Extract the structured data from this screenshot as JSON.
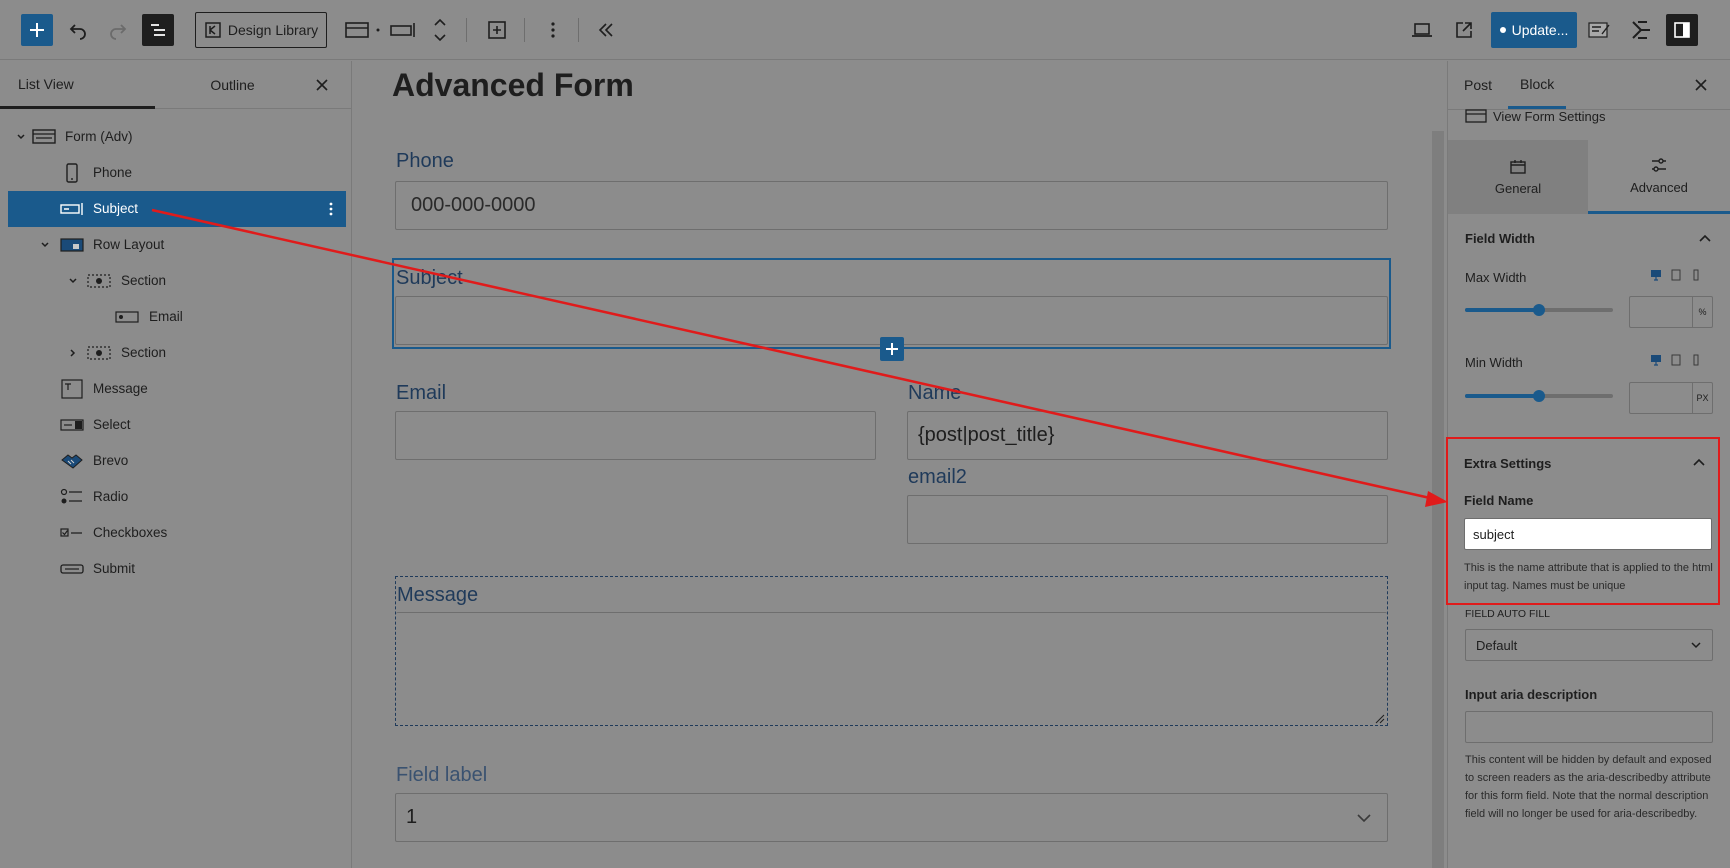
{
  "toolbar": {
    "design_library_label": "Design Library",
    "update_label": "Update..."
  },
  "left_panel": {
    "tabs": [
      {
        "label": "List View",
        "active": true
      },
      {
        "label": "Outline",
        "active": false
      }
    ],
    "tree": [
      {
        "label": "Form (Adv)",
        "icon": "form-icon",
        "depth": 0,
        "expander": "expanded"
      },
      {
        "label": "Phone",
        "icon": "phone-icon",
        "depth": 1
      },
      {
        "label": "Subject",
        "icon": "text-field-icon",
        "depth": 1,
        "selected": true
      },
      {
        "label": "Row Layout",
        "icon": "row-layout-icon",
        "depth": 1,
        "expander": "expanded"
      },
      {
        "label": "Section",
        "icon": "section-icon",
        "depth": 2,
        "expander": "expanded"
      },
      {
        "label": "Email",
        "icon": "email-field-icon",
        "depth": 3
      },
      {
        "label": "Section",
        "icon": "section-icon",
        "depth": 2,
        "expander": "collapsed"
      },
      {
        "label": "Message",
        "icon": "textarea-icon",
        "depth": 1
      },
      {
        "label": "Select",
        "icon": "select-icon",
        "depth": 1
      },
      {
        "label": "Brevo",
        "icon": "handshake-icon",
        "depth": 1
      },
      {
        "label": "Radio",
        "icon": "radio-icon",
        "depth": 1
      },
      {
        "label": "Checkboxes",
        "icon": "checkbox-icon",
        "depth": 1
      },
      {
        "label": "Submit",
        "icon": "submit-icon",
        "depth": 1
      }
    ]
  },
  "canvas": {
    "title": "Advanced Form",
    "phone_label": "Phone",
    "phone_placeholder": "000-000-0000",
    "subject_label": "Subject",
    "email_label": "Email",
    "name_label": "Name",
    "name_value": "{post|post_title}",
    "email2_label": "email2",
    "message_label": "Message",
    "select_label": "Field label",
    "select_value": "1"
  },
  "right_panel": {
    "tabs": [
      {
        "label": "Post",
        "active": false
      },
      {
        "label": "Block",
        "active": true
      }
    ],
    "view_form_settings": "View Form Settings",
    "segments": [
      {
        "label": "General",
        "icon": "calendar-icon",
        "active": false
      },
      {
        "label": "Advanced",
        "icon": "sliders-icon",
        "active": true
      }
    ],
    "field_width": {
      "title": "Field Width",
      "max_width_label": "Max Width",
      "max_width_unit": "%",
      "max_width_level": 0.5,
      "min_width_label": "Min Width",
      "min_width_unit": "PX",
      "min_width_level": 0.5
    },
    "extra_settings": {
      "title": "Extra Settings",
      "field_name_label": "Field Name",
      "field_name_value": "subject",
      "field_name_help": "This is the name attribute that is applied to the html input tag. Names must be unique"
    },
    "auto_fill": {
      "label": "FIELD AUTO FILL",
      "value": "Default"
    },
    "aria": {
      "label": "Input aria description",
      "help": "This content will be hidden by default and exposed to screen readers as the aria-describedby attribute for this form field. Note that the normal description field will no longer be used for aria-describedby."
    }
  },
  "colors": {
    "accent": "#1a5a8c",
    "annotation": "#e01b1b",
    "overlay": "#8c8c8c"
  }
}
